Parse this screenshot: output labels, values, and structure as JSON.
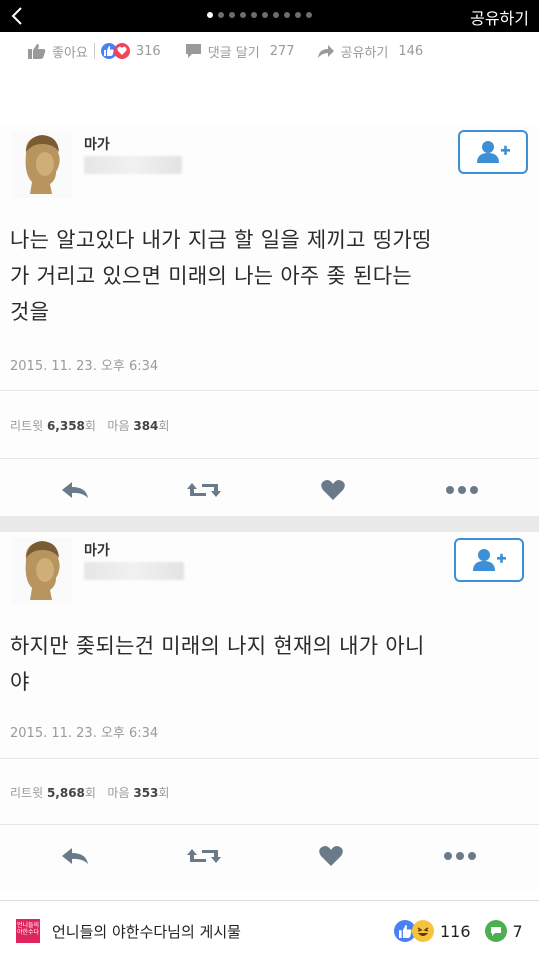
{
  "topbar": {
    "share_label": "공유하기",
    "dot_count": 10,
    "active_dot": 0
  },
  "actionbar": {
    "like_label": "좋아요",
    "reaction_count": "316",
    "comment_label": "댓글 달기",
    "comment_count": "277",
    "share_label": "공유하기",
    "share_count": "146"
  },
  "tweets": [
    {
      "name": "마가",
      "text_line1": "나는 알고있다 내가 지금 할 일을 제끼고 띵가띵",
      "text_line2": "가 거리고 있으면 미래의 나는 아주 좆 된다는",
      "text_line3": "것을",
      "date": "2015. 11. 23. 오후 6:34",
      "retweet_label": "리트윗",
      "retweet_count": "6,358",
      "retweet_unit": "회",
      "like_label": "마음",
      "like_count": "384",
      "like_unit": "회"
    },
    {
      "name": "마가",
      "text_line1": "하지만 좆되는건 미래의 나지 현재의 내가 아니",
      "text_line2": "야",
      "date": "2015. 11. 23. 오후 6:34",
      "retweet_label": "리트윗",
      "retweet_count": "5,868",
      "retweet_unit": "회",
      "like_label": "마음",
      "like_count": "353",
      "like_unit": "회"
    }
  ],
  "footer": {
    "page_logo_text": "언니들의 야한수다",
    "page_name": "언니들의 야한수다님의 게시물",
    "reaction_count": "116",
    "comment_count": "7"
  },
  "colors": {
    "facebook_blue": "#4a80f5",
    "love_red": "#f0445e",
    "twitter_blue": "#3d8fd6",
    "comment_green": "#4caf50"
  }
}
